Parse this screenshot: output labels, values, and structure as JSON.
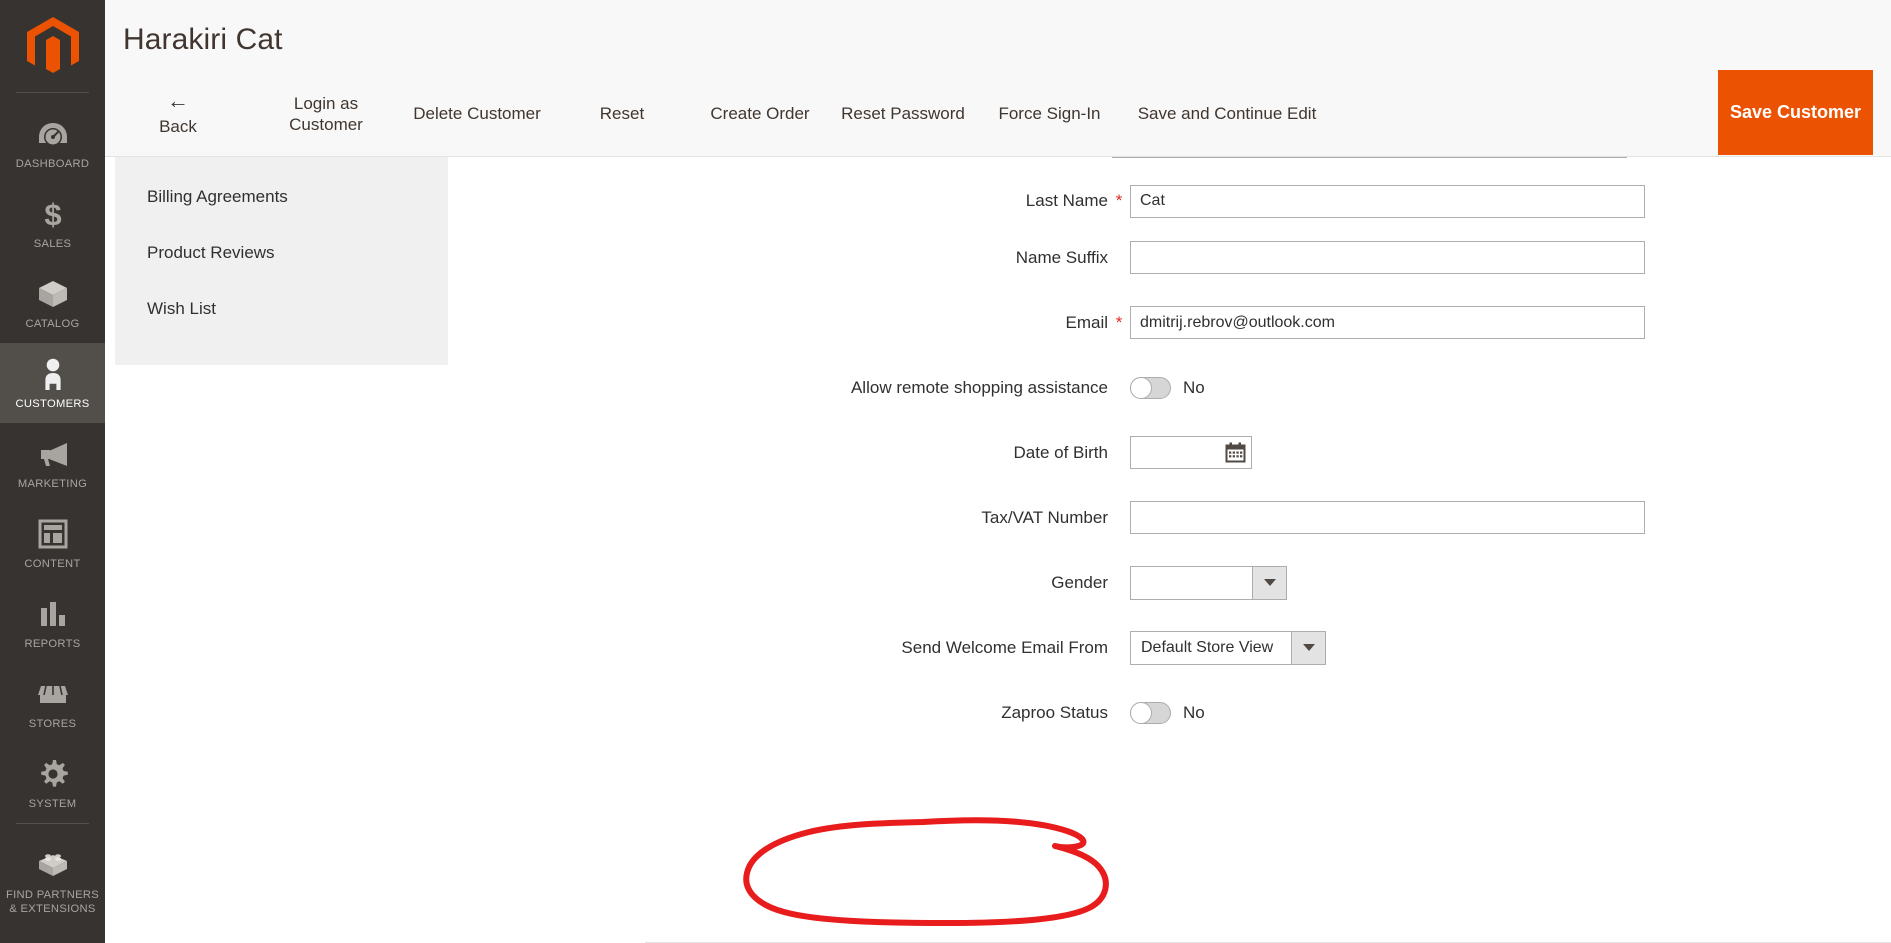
{
  "sidebar": {
    "logo_name": "magento-logo",
    "items": [
      {
        "label": "DASHBOARD",
        "icon": "dashboard-gauge-icon",
        "active": false
      },
      {
        "label": "SALES",
        "icon": "dollar-sign-icon",
        "active": false
      },
      {
        "label": "CATALOG",
        "icon": "box-icon",
        "active": false
      },
      {
        "label": "CUSTOMERS",
        "icon": "person-icon",
        "active": true
      },
      {
        "label": "MARKETING",
        "icon": "megaphone-icon",
        "active": false
      },
      {
        "label": "CONTENT",
        "icon": "layout-window-icon",
        "active": false
      },
      {
        "label": "REPORTS",
        "icon": "bar-chart-icon",
        "active": false
      },
      {
        "label": "STORES",
        "icon": "storefront-icon",
        "active": false
      },
      {
        "label": "SYSTEM",
        "icon": "gear-icon",
        "active": false
      },
      {
        "label": "FIND PARTNERS & EXTENSIONS",
        "icon": "lego-brick-icon",
        "active": false
      }
    ]
  },
  "header": {
    "title": "Harakiri Cat",
    "actions": {
      "back": "Back",
      "back_icon": "arrow-left-icon",
      "login_as_customer": "Login as Customer",
      "delete_customer": "Delete Customer",
      "reset": "Reset",
      "create_order": "Create Order",
      "reset_password": "Reset Password",
      "force_sign_in": "Force Sign-In",
      "save_and_continue_edit": "Save and Continue Edit",
      "save_customer": "Save Customer"
    }
  },
  "subnav": {
    "items": [
      {
        "label": "Billing Agreements"
      },
      {
        "label": "Product Reviews"
      },
      {
        "label": "Wish List"
      }
    ]
  },
  "form": {
    "last_name": {
      "label": "Last Name",
      "required": "*",
      "value": "Cat"
    },
    "name_suffix": {
      "label": "Name Suffix",
      "value": ""
    },
    "email": {
      "label": "Email",
      "required": "*",
      "value": "dmitrij.rebrov@outlook.com"
    },
    "remote_assistance": {
      "label": "Allow remote shopping assistance",
      "value": "No",
      "state": "off"
    },
    "date_of_birth": {
      "label": "Date of Birth",
      "value": "",
      "icon": "calendar-icon"
    },
    "tax_vat": {
      "label": "Tax/VAT Number",
      "value": ""
    },
    "gender": {
      "label": "Gender",
      "value": "",
      "icon": "chevron-down-icon"
    },
    "welcome_email_from": {
      "label": "Send Welcome Email From",
      "value": "Default Store View",
      "icon": "chevron-down-icon"
    },
    "zaproo_status": {
      "label": "Zaproo Status",
      "value": "No",
      "state": "off"
    }
  },
  "annotation": {
    "name": "red-highlight-circle",
    "color": "#e81c1c",
    "target": "Zaproo Status"
  },
  "colors": {
    "accent": "#eb5202",
    "sidebar_bg": "#373330",
    "header_bg": "#f8f8f8",
    "required_star": "#e02b27"
  }
}
